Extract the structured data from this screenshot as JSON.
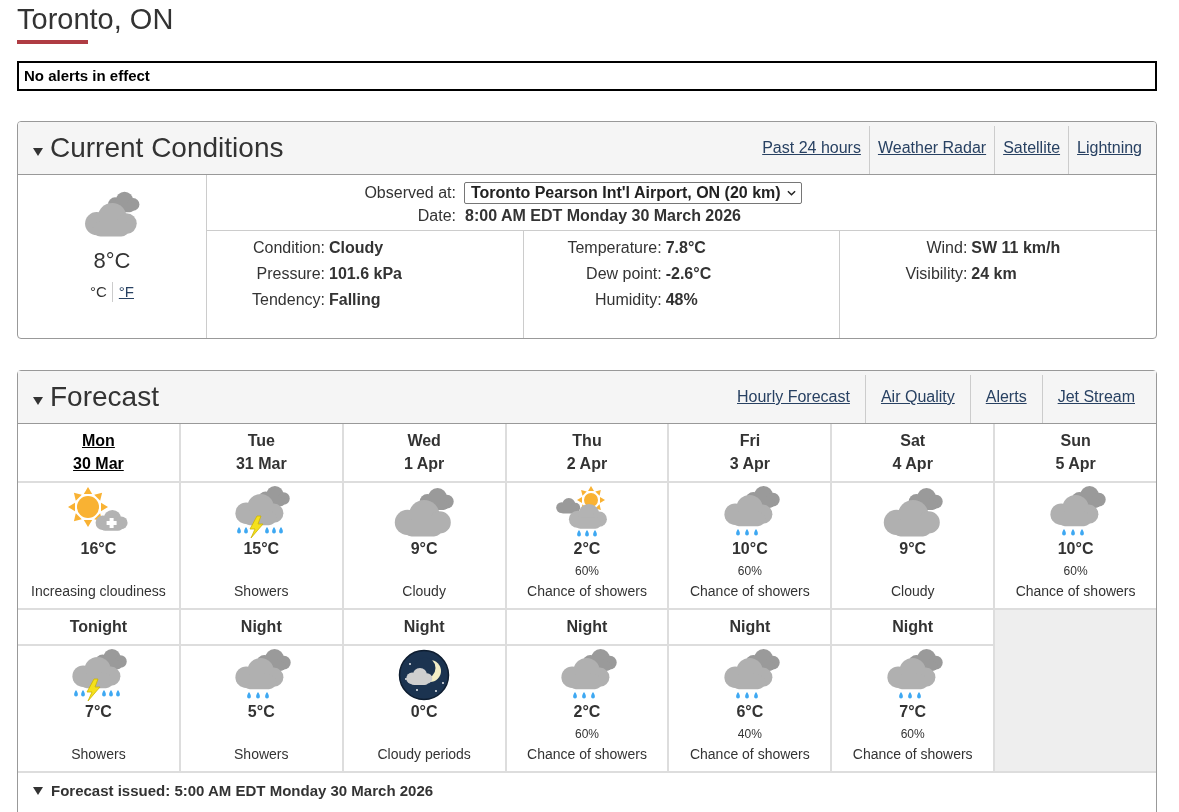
{
  "page_title": "Toronto, ON",
  "alert_banner": "No alerts in effect",
  "current_conditions": {
    "title": "Current Conditions",
    "expanded": true,
    "links": [
      "Past 24 hours",
      "Weather Radar",
      "Satellite",
      "Lightning"
    ],
    "kind": "cloudy",
    "temperature": "8°C",
    "units": [
      {
        "label": "°C",
        "selected": true
      },
      {
        "label": "°F",
        "selected": false
      }
    ],
    "observed_at": {
      "label": "Observed at:",
      "value": "Toronto Pearson Int'l Airport, ON (20 km)"
    },
    "date": {
      "label": "Date:",
      "value": "8:00 AM EDT Monday 30 March 2026"
    },
    "columns": [
      [
        {
          "label": "Condition:",
          "value": "Cloudy"
        },
        {
          "label": "Pressure:",
          "value": "101.6 kPa"
        },
        {
          "label": "Tendency:",
          "value": "Falling"
        }
      ],
      [
        {
          "label": "Temperature:",
          "value": "7.8°C"
        },
        {
          "label": "Dew point:",
          "value": "-2.6°C"
        },
        {
          "label": "Humidity:",
          "value": "48%"
        }
      ],
      [
        {
          "label": "Wind:",
          "value": "SW 11 km/h"
        },
        {
          "label": "Visibility:",
          "value": "24 km"
        }
      ]
    ]
  },
  "forecast": {
    "title": "Forecast",
    "expanded": true,
    "links": [
      "Hourly Forecast",
      "Air Quality",
      "Alerts",
      "Jet Stream"
    ],
    "days": [
      {
        "day": "Mon",
        "date": "30 Mar",
        "selected": true,
        "daytime": {
          "kind": "sun-cloud",
          "temperature": "16°C",
          "summary": "Increasing cloudiness"
        },
        "night": {
          "label": "Tonight",
          "kind": "thunderstorm",
          "temperature": "7°C",
          "summary": "Showers"
        }
      },
      {
        "day": "Tue",
        "date": "31 Mar",
        "selected": false,
        "daytime": {
          "kind": "thunderstorm",
          "temperature": "15°C",
          "summary": "Showers"
        },
        "night": {
          "label": "Night",
          "kind": "showers",
          "temperature": "5°C",
          "summary": "Showers"
        }
      },
      {
        "day": "Wed",
        "date": "1 Apr",
        "selected": false,
        "daytime": {
          "kind": "cloudy",
          "temperature": "9°C",
          "summary": "Cloudy"
        },
        "night": {
          "label": "Night",
          "kind": "night-cloudy",
          "temperature": "0°C",
          "summary": "Cloudy periods"
        }
      },
      {
        "day": "Thu",
        "date": "2 Apr",
        "selected": false,
        "daytime": {
          "kind": "sun-showers",
          "temperature": "2°C",
          "pop": "60%",
          "summary": "Chance of showers"
        },
        "night": {
          "label": "Night",
          "kind": "showers",
          "temperature": "2°C",
          "pop": "60%",
          "summary": "Chance of showers"
        }
      },
      {
        "day": "Fri",
        "date": "3 Apr",
        "selected": false,
        "daytime": {
          "kind": "showers",
          "temperature": "10°C",
          "pop": "60%",
          "summary": "Chance of showers"
        },
        "night": {
          "label": "Night",
          "kind": "showers",
          "temperature": "6°C",
          "pop": "40%",
          "summary": "Chance of showers"
        }
      },
      {
        "day": "Sat",
        "date": "4 Apr",
        "selected": false,
        "daytime": {
          "kind": "cloudy",
          "temperature": "9°C",
          "summary": "Cloudy"
        },
        "night": {
          "label": "Night",
          "kind": "showers",
          "temperature": "7°C",
          "pop": "60%",
          "summary": "Chance of showers"
        }
      },
      {
        "day": "Sun",
        "date": "5 Apr",
        "selected": false,
        "daytime": {
          "kind": "showers",
          "temperature": "10°C",
          "pop": "60%",
          "summary": "Chance of showers"
        }
      }
    ],
    "issued": {
      "expanded": true,
      "text": "Forecast issued: 5:00 AM EDT Monday 30 March 2026"
    }
  }
}
